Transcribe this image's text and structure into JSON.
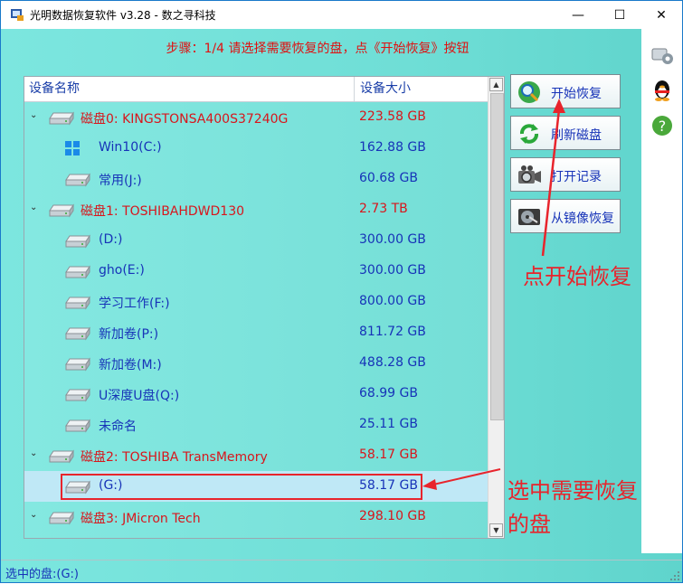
{
  "window": {
    "title": "光明数据恢复软件 v3.28 - 数之寻科技",
    "controls": {
      "minimize": "—",
      "maximize": "☐",
      "close": "✕"
    }
  },
  "step_text": "步骤：1/4 请选择需要恢复的盘，点《开始恢复》按钮",
  "list": {
    "headers": [
      "设备名称",
      "设备大小"
    ],
    "rows": [
      {
        "kind": "disk",
        "name": "磁盘0: KINGSTONSA400S37240G",
        "size": "223.58 GB",
        "expanded": true
      },
      {
        "kind": "part",
        "name": "Win10(C:)",
        "size": "162.88 GB",
        "icon": "windows-icon"
      },
      {
        "kind": "part",
        "name": "常用(J:)",
        "size": "60.68 GB",
        "icon": "drive-icon"
      },
      {
        "kind": "disk",
        "name": "磁盘1: TOSHIBAHDWD130",
        "size": "2.73 TB",
        "expanded": true
      },
      {
        "kind": "part",
        "name": "(D:)",
        "size": "300.00 GB",
        "icon": "drive-icon"
      },
      {
        "kind": "part",
        "name": "gho(E:)",
        "size": "300.00 GB",
        "icon": "drive-icon"
      },
      {
        "kind": "part",
        "name": "学习工作(F:)",
        "size": "800.00 GB",
        "icon": "drive-icon"
      },
      {
        "kind": "part",
        "name": "新加卷(P:)",
        "size": "811.72 GB",
        "icon": "drive-icon"
      },
      {
        "kind": "part",
        "name": "新加卷(M:)",
        "size": "488.28 GB",
        "icon": "drive-icon"
      },
      {
        "kind": "part",
        "name": "U深度U盘(Q:)",
        "size": "68.99 GB",
        "icon": "drive-icon"
      },
      {
        "kind": "part",
        "name": "未命名",
        "size": "25.11 GB",
        "icon": "drive-icon"
      },
      {
        "kind": "disk",
        "name": "磁盘2: TOSHIBA  TransMemory",
        "size": "58.17 GB",
        "expanded": true
      },
      {
        "kind": "part",
        "name": "(G:)",
        "size": "58.17 GB",
        "icon": "drive-icon",
        "selected": true
      },
      {
        "kind": "disk",
        "name": "磁盘3: JMicron  Tech",
        "size": "298.10 GB",
        "expanded": true
      }
    ]
  },
  "buttons": {
    "start": "开始恢复",
    "refresh": "刷新磁盘",
    "open_record": "打开记录",
    "from_image": "从镜像恢复"
  },
  "annotations": {
    "click_start": "点开始恢复",
    "select_disk_line1": "选中需要恢复",
    "select_disk_line2": "的盘"
  },
  "status": "选中的盘:(G:)",
  "colors": {
    "disk_text": "#d8161c",
    "partition_text": "#1733b8",
    "annotation": "#e8242c",
    "background": "#74ded6"
  }
}
